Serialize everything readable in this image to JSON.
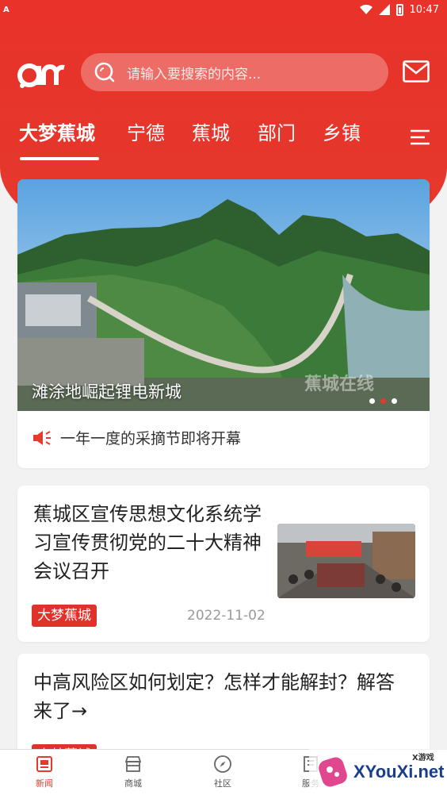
{
  "status_bar": {
    "carrier_glyph": "A",
    "time": "10:47"
  },
  "header": {
    "logo_text": "am",
    "search_placeholder": "请输入要搜索的内容...",
    "tabs": [
      "大梦蕉城",
      "宁德",
      "蕉城",
      "部门",
      "乡镇"
    ]
  },
  "banner": {
    "caption": "滩涂地崛起锂电新城",
    "watermark": "蕉城在线",
    "active_dot": 2,
    "notice": "一年一度的采摘节即将开幕"
  },
  "articles": [
    {
      "title": "蕉城区宣传思想文化系统学习宣传贯彻党的二十大精神会议召开",
      "tag": "大梦蕉城",
      "date": "2022-11-02"
    },
    {
      "title": "中高风险区如何划定？怎样才能解封？解答来了→",
      "tag": "大梦蕉城"
    }
  ],
  "bottom_nav": [
    {
      "label": "新闻",
      "icon": "news-icon",
      "active": true
    },
    {
      "label": "商城",
      "icon": "store-icon",
      "active": false
    },
    {
      "label": "社区",
      "icon": "compass-icon",
      "active": false
    },
    {
      "label": "服务",
      "icon": "service-icon",
      "active": false
    }
  ],
  "site_watermark": {
    "brand": "XYouXi.net",
    "label": "X游戏"
  },
  "colors": {
    "accent": "#e53a2e",
    "text": "#222222",
    "muted": "#999999"
  }
}
